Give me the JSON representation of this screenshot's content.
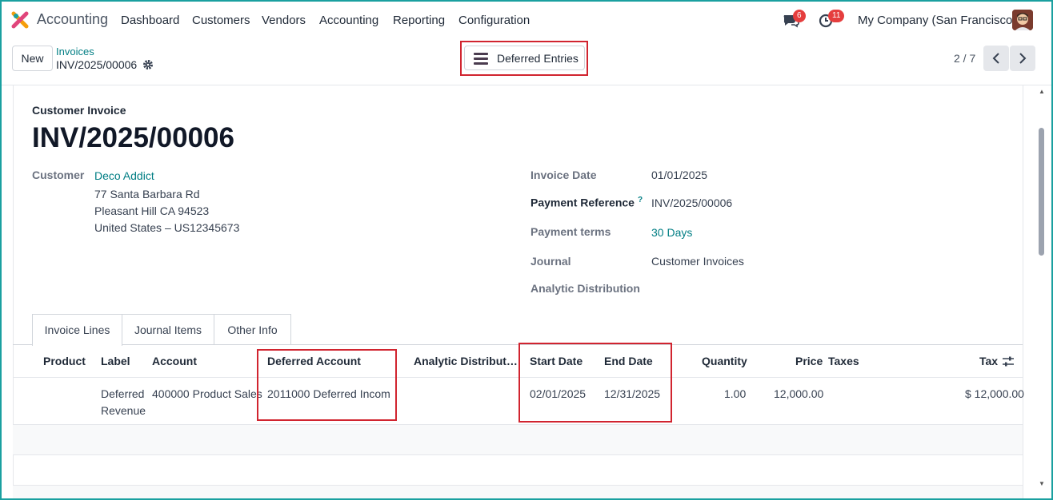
{
  "nav": {
    "app_name": "Accounting",
    "menu": [
      "Dashboard",
      "Customers",
      "Vendors",
      "Accounting",
      "Reporting",
      "Configuration"
    ],
    "messages_badge": "6",
    "activities_badge": "11",
    "company": "My Company (San Francisco)"
  },
  "control_panel": {
    "new_label": "New",
    "breadcrumb": "Invoices",
    "record_name": "INV/2025/00006",
    "deferred_button": "Deferred Entries",
    "pager": "2 / 7"
  },
  "form": {
    "doc_type": "Customer Invoice",
    "title": "INV/2025/00006",
    "customer_label": "Customer",
    "customer_name": "Deco Addict",
    "customer_address": [
      "77 Santa Barbara Rd",
      "Pleasant Hill CA 94523",
      "United States – US12345673"
    ],
    "invoice_date_label": "Invoice Date",
    "invoice_date": "01/01/2025",
    "payment_ref_label": "Payment Reference",
    "payment_ref_help": "?",
    "payment_ref": "INV/2025/00006",
    "payment_terms_label": "Payment terms",
    "payment_terms": "30 Days",
    "journal_label": "Journal",
    "journal": "Customer Invoices",
    "analytic_label": "Analytic Distribution"
  },
  "tabs": [
    "Invoice Lines",
    "Journal Items",
    "Other Info"
  ],
  "lines": {
    "columns": [
      "Product",
      "Label",
      "Account",
      "Deferred Account",
      "Analytic Distribut…",
      "Start Date",
      "End Date",
      "Quantity",
      "Price",
      "Taxes",
      "Tax"
    ],
    "rows": [
      {
        "product": "",
        "label_line1": "Deferred",
        "label_line2": "Revenue",
        "account": "400000 Product Sales",
        "deferred_account": "2011000 Deferred Incom",
        "analytic": "",
        "start_date": "02/01/2025",
        "end_date": "12/31/2025",
        "quantity": "1.00",
        "price": "12,000.00",
        "taxes": "",
        "tax": "$ 12,000.00"
      }
    ]
  },
  "colors": {
    "accent": "#017e84",
    "highlight": "#d1242f",
    "badge": "#e53e3e"
  }
}
